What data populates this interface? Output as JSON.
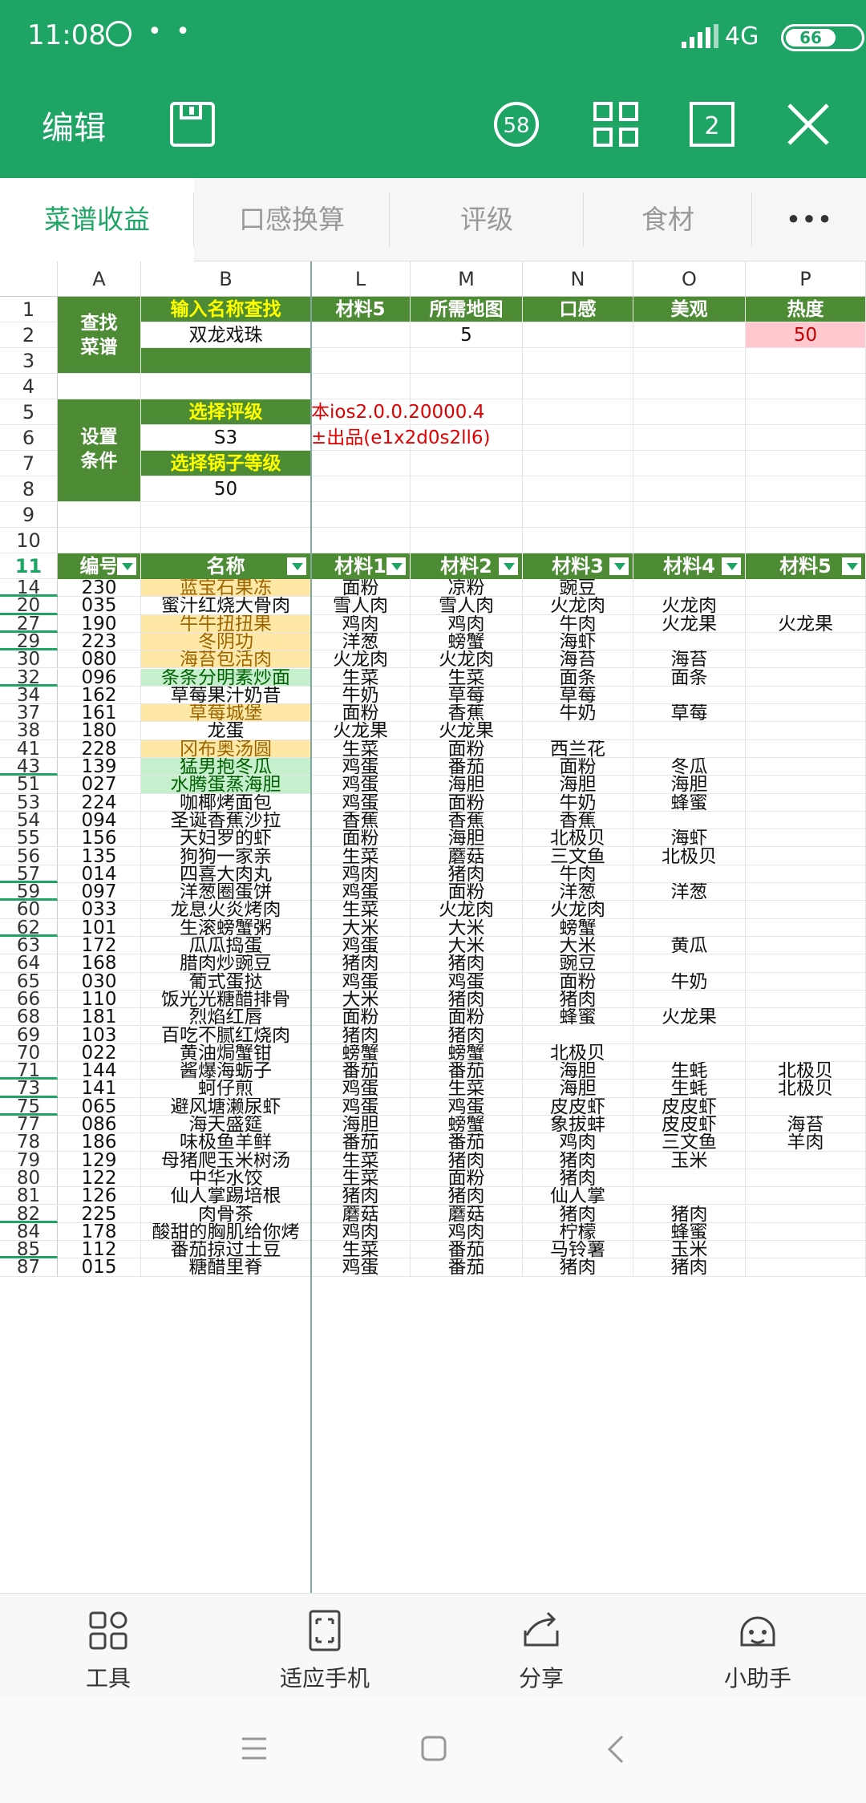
{
  "status_bar": {
    "time": "11:08",
    "dots": "• •",
    "network": "4G",
    "battery": "66"
  },
  "toolbar": {
    "edit_label": "编辑",
    "badge_count": "58",
    "window_count": "2"
  },
  "tabs": [
    {
      "label": "菜谱收益",
      "active": true
    },
    {
      "label": "口感换算",
      "active": false
    },
    {
      "label": "评级",
      "active": false
    },
    {
      "label": "食材",
      "active": false
    },
    {
      "label": "•••",
      "active": false
    }
  ],
  "columns": [
    "A",
    "B",
    "L",
    "M",
    "N",
    "O",
    "P"
  ],
  "top_rows": [
    "1",
    "2",
    "3",
    "4",
    "5",
    "6",
    "7",
    "8",
    "9",
    "10",
    "11"
  ],
  "top_section": {
    "search_label": "查找\n菜谱",
    "search_header": "输入名称查找",
    "search_value": "双龙戏珠",
    "settings_label": "设置\n条件",
    "rating_header": "选择评级",
    "rating_value": "S3",
    "pot_header": "选择锅子等级",
    "pot_value": "50",
    "col_headers": [
      "材料5",
      "所需地图",
      "口感",
      "美观",
      "热度"
    ],
    "row2_values": [
      "",
      "5",
      "",
      "",
      "50"
    ],
    "version_text": "本ios2.0.0.20000.4",
    "author_text": "±出品(e1x2d0s2ll6)"
  },
  "filter_headers": [
    "编号",
    "名称",
    "材料1",
    "材料2",
    "材料3",
    "材料4",
    "材料5"
  ],
  "rows": [
    {
      "r": "14",
      "id": "230",
      "name": "蓝宝石果冻",
      "hl": "y",
      "m": [
        "面粉",
        "凉粉",
        "豌豆",
        "",
        ""
      ]
    },
    {
      "r": "20",
      "id": "035",
      "name": "蜜汁红烧大骨肉",
      "hl": "",
      "m": [
        "雪人肉",
        "雪人肉",
        "火龙肉",
        "火龙肉",
        ""
      ]
    },
    {
      "r": "27",
      "id": "190",
      "name": "牛牛扭扭果",
      "hl": "y",
      "m": [
        "鸡肉",
        "鸡肉",
        "牛肉",
        "火龙果",
        "火龙果"
      ]
    },
    {
      "r": "29",
      "id": "223",
      "name": "冬阴功",
      "hl": "y",
      "m": [
        "洋葱",
        "螃蟹",
        "海虾",
        "",
        ""
      ]
    },
    {
      "r": "30",
      "id": "080",
      "name": "海苔包活肉",
      "hl": "y",
      "m": [
        "火龙肉",
        "火龙肉",
        "海苔",
        "海苔",
        ""
      ]
    },
    {
      "r": "32",
      "id": "096",
      "name": "条条分明素炒面",
      "hl": "g",
      "m": [
        "生菜",
        "生菜",
        "面条",
        "面条",
        ""
      ]
    },
    {
      "r": "34",
      "id": "162",
      "name": "草莓果汁奶昔",
      "hl": "",
      "m": [
        "牛奶",
        "草莓",
        "草莓",
        "",
        ""
      ]
    },
    {
      "r": "37",
      "id": "161",
      "name": "草莓城堡",
      "hl": "y",
      "m": [
        "面粉",
        "香蕉",
        "牛奶",
        "草莓",
        ""
      ]
    },
    {
      "r": "38",
      "id": "180",
      "name": "龙蛋",
      "hl": "",
      "m": [
        "火龙果",
        "火龙果",
        "",
        "",
        ""
      ]
    },
    {
      "r": "41",
      "id": "228",
      "name": "冈布奥汤圆",
      "hl": "y",
      "m": [
        "生菜",
        "面粉",
        "西兰花",
        "",
        ""
      ]
    },
    {
      "r": "43",
      "id": "139",
      "name": "猛男抱冬瓜",
      "hl": "g",
      "m": [
        "鸡蛋",
        "番茄",
        "面粉",
        "冬瓜",
        ""
      ]
    },
    {
      "r": "51",
      "id": "027",
      "name": "水腾蛋蒸海胆",
      "hl": "g",
      "m": [
        "鸡蛋",
        "海胆",
        "海胆",
        "海胆",
        ""
      ]
    },
    {
      "r": "53",
      "id": "224",
      "name": "咖椰烤面包",
      "hl": "",
      "m": [
        "鸡蛋",
        "面粉",
        "牛奶",
        "蜂蜜",
        ""
      ]
    },
    {
      "r": "54",
      "id": "094",
      "name": "圣诞香蕉沙拉",
      "hl": "",
      "m": [
        "香蕉",
        "香蕉",
        "香蕉",
        "",
        ""
      ]
    },
    {
      "r": "55",
      "id": "156",
      "name": "天妇罗的虾",
      "hl": "",
      "m": [
        "面粉",
        "海胆",
        "北极贝",
        "海虾",
        ""
      ]
    },
    {
      "r": "56",
      "id": "135",
      "name": "狗狗一家亲",
      "hl": "",
      "m": [
        "生菜",
        "蘑菇",
        "三文鱼",
        "北极贝",
        ""
      ]
    },
    {
      "r": "57",
      "id": "014",
      "name": "四喜大肉丸",
      "hl": "",
      "m": [
        "鸡肉",
        "猪肉",
        "牛肉",
        "",
        ""
      ]
    },
    {
      "r": "59",
      "id": "097",
      "name": "洋葱圈蛋饼",
      "hl": "",
      "m": [
        "鸡蛋",
        "面粉",
        "洋葱",
        "洋葱",
        ""
      ]
    },
    {
      "r": "60",
      "id": "033",
      "name": "龙息火炎烤肉",
      "hl": "",
      "m": [
        "生菜",
        "火龙肉",
        "火龙肉",
        "",
        ""
      ]
    },
    {
      "r": "62",
      "id": "101",
      "name": "生滚螃蟹粥",
      "hl": "",
      "m": [
        "大米",
        "大米",
        "螃蟹",
        "",
        ""
      ]
    },
    {
      "r": "63",
      "id": "172",
      "name": "瓜瓜捣蛋",
      "hl": "",
      "m": [
        "鸡蛋",
        "大米",
        "大米",
        "黄瓜",
        ""
      ]
    },
    {
      "r": "64",
      "id": "168",
      "name": "腊肉炒豌豆",
      "hl": "",
      "m": [
        "猪肉",
        "猪肉",
        "豌豆",
        "",
        ""
      ]
    },
    {
      "r": "65",
      "id": "030",
      "name": "葡式蛋挞",
      "hl": "",
      "m": [
        "鸡蛋",
        "鸡蛋",
        "面粉",
        "牛奶",
        ""
      ]
    },
    {
      "r": "66",
      "id": "110",
      "name": "饭光光糖醋排骨",
      "hl": "",
      "m": [
        "大米",
        "猪肉",
        "猪肉",
        "",
        ""
      ]
    },
    {
      "r": "68",
      "id": "181",
      "name": "烈焰红唇",
      "hl": "",
      "m": [
        "面粉",
        "面粉",
        "蜂蜜",
        "火龙果",
        ""
      ]
    },
    {
      "r": "69",
      "id": "103",
      "name": "百吃不腻红烧肉",
      "hl": "",
      "m": [
        "猪肉",
        "猪肉",
        "",
        "",
        ""
      ]
    },
    {
      "r": "70",
      "id": "022",
      "name": "黄油焗蟹钳",
      "hl": "",
      "m": [
        "螃蟹",
        "螃蟹",
        "北极贝",
        "",
        ""
      ]
    },
    {
      "r": "71",
      "id": "144",
      "name": "酱爆海蛎子",
      "hl": "",
      "m": [
        "番茄",
        "番茄",
        "海胆",
        "生蚝",
        "北极贝"
      ]
    },
    {
      "r": "73",
      "id": "141",
      "name": "蚵仔煎",
      "hl": "",
      "m": [
        "鸡蛋",
        "生菜",
        "海胆",
        "生蚝",
        "北极贝"
      ]
    },
    {
      "r": "75",
      "id": "065",
      "name": "避风塘濑尿虾",
      "hl": "",
      "m": [
        "鸡蛋",
        "鸡蛋",
        "皮皮虾",
        "皮皮虾",
        ""
      ]
    },
    {
      "r": "77",
      "id": "086",
      "name": "海天盛筵",
      "hl": "",
      "m": [
        "海胆",
        "螃蟹",
        "象拔蚌",
        "皮皮虾",
        "海苔"
      ]
    },
    {
      "r": "78",
      "id": "186",
      "name": "味极鱼羊鲜",
      "hl": "",
      "m": [
        "番茄",
        "番茄",
        "鸡肉",
        "三文鱼",
        "羊肉"
      ]
    },
    {
      "r": "79",
      "id": "129",
      "name": "母猪爬玉米树汤",
      "hl": "",
      "m": [
        "生菜",
        "猪肉",
        "猪肉",
        "玉米",
        ""
      ]
    },
    {
      "r": "80",
      "id": "122",
      "name": "中华水饺",
      "hl": "",
      "m": [
        "生菜",
        "面粉",
        "猪肉",
        "",
        ""
      ]
    },
    {
      "r": "81",
      "id": "126",
      "name": "仙人掌踢培根",
      "hl": "",
      "m": [
        "猪肉",
        "猪肉",
        "仙人掌",
        "",
        ""
      ]
    },
    {
      "r": "82",
      "id": "225",
      "name": "肉骨茶",
      "hl": "",
      "m": [
        "蘑菇",
        "蘑菇",
        "猪肉",
        "猪肉",
        ""
      ]
    },
    {
      "r": "84",
      "id": "178",
      "name": "酸甜的胸肌给你烤",
      "hl": "",
      "m": [
        "鸡肉",
        "鸡肉",
        "柠檬",
        "蜂蜜",
        ""
      ]
    },
    {
      "r": "85",
      "id": "112",
      "name": "番茄掠过土豆",
      "hl": "",
      "m": [
        "生菜",
        "番茄",
        "马铃薯",
        "玉米",
        ""
      ]
    },
    {
      "r": "87",
      "id": "015",
      "name": "糖醋里脊",
      "hl": "",
      "m": [
        "鸡蛋",
        "番茄",
        "猪肉",
        "猪肉",
        ""
      ]
    }
  ],
  "bottom_tools": [
    {
      "label": "工具",
      "icon": "tools-icon"
    },
    {
      "label": "适应手机",
      "icon": "fit-screen-icon"
    },
    {
      "label": "分享",
      "icon": "share-icon"
    },
    {
      "label": "小助手",
      "icon": "assistant-icon"
    }
  ],
  "colors": {
    "brand": "#1ea566",
    "header_green": "#4e8b35",
    "yellow_text": "#ffff00",
    "yellow_hl": "#ffe8a6",
    "green_hl": "#c6efce",
    "pink": "#ffc7ce"
  }
}
